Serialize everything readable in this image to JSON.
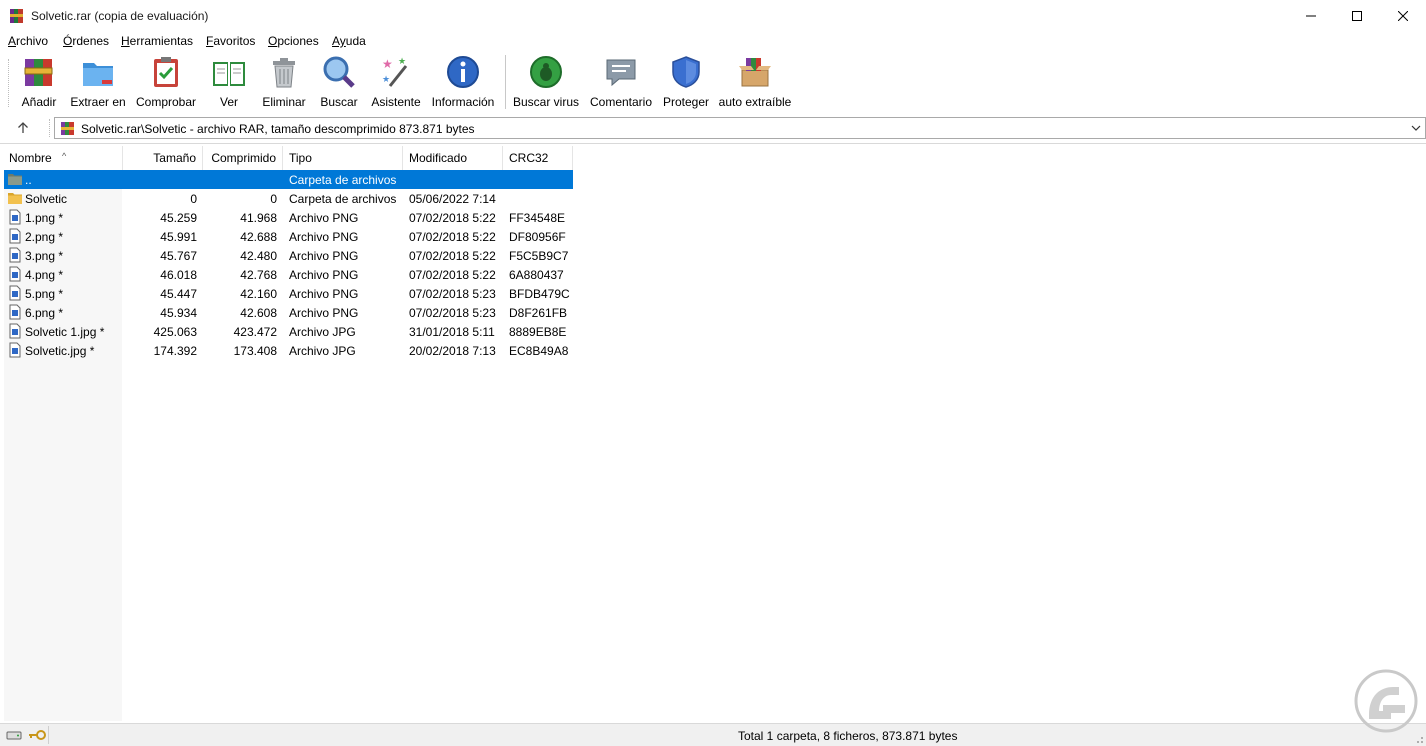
{
  "window": {
    "title": "Solvetic.rar (copia de evaluación)"
  },
  "menu": [
    {
      "u": "A",
      "rest": "rchivo"
    },
    {
      "u": "Ó",
      "rest": "rdenes"
    },
    {
      "u": "H",
      "rest": "erramientas"
    },
    {
      "u": "F",
      "rest": "avoritos"
    },
    {
      "u": "O",
      "rest": "pciones"
    },
    {
      "u": "Ay",
      "rest": "uda"
    }
  ],
  "toolbar": {
    "add": "Añadir",
    "extract": "Extraer en",
    "test": "Comprobar",
    "view": "Ver",
    "delete": "Eliminar",
    "find": "Buscar",
    "wizard": "Asistente",
    "info": "Información",
    "virus": "Buscar virus",
    "comment": "Comentario",
    "protect": "Proteger",
    "sfx": "auto extraíble"
  },
  "address": {
    "path": "Solvetic.rar\\Solvetic - archivo RAR, tamaño descomprimido 873.871 bytes"
  },
  "columns": {
    "name": "Nombre",
    "size": "Tamaño",
    "packed": "Comprimido",
    "type": "Tipo",
    "modified": "Modificado",
    "crc": "CRC32"
  },
  "files": [
    {
      "name": "..",
      "size": "",
      "packed": "",
      "type": "Carpeta de archivos",
      "modified": "",
      "crc": "",
      "icon": "parent-folder-icon",
      "selected": true
    },
    {
      "name": "Solvetic",
      "size": "0",
      "packed": "0",
      "type": "Carpeta de archivos",
      "modified": "05/06/2022 7:14",
      "crc": "",
      "icon": "folder-icon"
    },
    {
      "name": "1.png *",
      "size": "45.259",
      "packed": "41.968",
      "type": "Archivo PNG",
      "modified": "07/02/2018 5:22",
      "crc": "FF34548E",
      "icon": "image-file-icon"
    },
    {
      "name": "2.png *",
      "size": "45.991",
      "packed": "42.688",
      "type": "Archivo PNG",
      "modified": "07/02/2018 5:22",
      "crc": "DF80956F",
      "icon": "image-file-icon"
    },
    {
      "name": "3.png *",
      "size": "45.767",
      "packed": "42.480",
      "type": "Archivo PNG",
      "modified": "07/02/2018 5:22",
      "crc": "F5C5B9C7",
      "icon": "image-file-icon"
    },
    {
      "name": "4.png *",
      "size": "46.018",
      "packed": "42.768",
      "type": "Archivo PNG",
      "modified": "07/02/2018 5:22",
      "crc": "6A880437",
      "icon": "image-file-icon"
    },
    {
      "name": "5.png *",
      "size": "45.447",
      "packed": "42.160",
      "type": "Archivo PNG",
      "modified": "07/02/2018 5:23",
      "crc": "BFDB479C",
      "icon": "image-file-icon"
    },
    {
      "name": "6.png *",
      "size": "45.934",
      "packed": "42.608",
      "type": "Archivo PNG",
      "modified": "07/02/2018 5:23",
      "crc": "D8F261FB",
      "icon": "image-file-icon"
    },
    {
      "name": "Solvetic 1.jpg *",
      "size": "425.063",
      "packed": "423.472",
      "type": "Archivo JPG",
      "modified": "31/01/2018 5:11",
      "crc": "8889EB8E",
      "icon": "image-file-icon"
    },
    {
      "name": "Solvetic.jpg *",
      "size": "174.392",
      "packed": "173.408",
      "type": "Archivo JPG",
      "modified": "20/02/2018 7:13",
      "crc": "EC8B49A8",
      "icon": "image-file-icon"
    }
  ],
  "status": {
    "summary": "Total 1 carpeta, 8 ficheros, 873.871 bytes"
  },
  "colors": {
    "selection": "#0078d7",
    "name_column_bg": "#f7f7f7"
  }
}
